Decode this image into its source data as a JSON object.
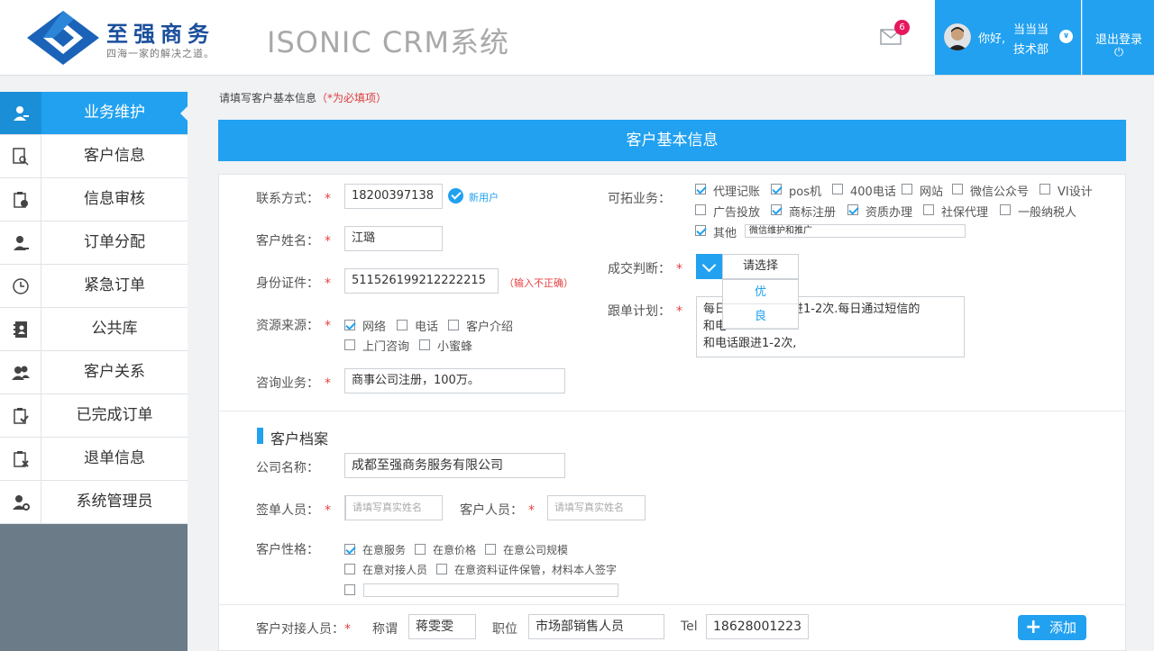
{
  "header": {
    "brand_name": "至强商务",
    "brand_tagline": "四海一家的解决之道。",
    "system_title": "ISONIC CRM系统",
    "mail_count": "6",
    "greeting": "你好,",
    "user_name": "当当当",
    "user_dept": "技术部",
    "logout_label": "退出登录",
    "logout_icon": "⏻"
  },
  "sidebar": {
    "items": [
      {
        "label": "业务维护",
        "icon": "user-edit-icon"
      },
      {
        "label": "客户信息",
        "icon": "search-doc-icon"
      },
      {
        "label": "信息审核",
        "icon": "clipboard-help-icon"
      },
      {
        "label": "订单分配",
        "icon": "user-dispatch-icon"
      },
      {
        "label": "紧急订单",
        "icon": "clock-icon"
      },
      {
        "label": "公共库",
        "icon": "contacts-book-icon"
      },
      {
        "label": "客户关系",
        "icon": "users-icon"
      },
      {
        "label": "已完成订单",
        "icon": "clipboard-check-icon"
      },
      {
        "label": "退单信息",
        "icon": "clipboard-x-icon"
      },
      {
        "label": "系统管理员",
        "icon": "user-gear-icon"
      }
    ]
  },
  "main": {
    "hint": "请填写客户基本信息",
    "hint_required": "（*为必填项）",
    "panel_title": "客户基本信息",
    "fields": {
      "contact_label": "联系方式：",
      "contact_value": "18200397138",
      "new_user": "新用户",
      "name_label": "客户姓名：",
      "name_value": "江璐",
      "id_label": "身份证件：",
      "id_value": "511526199212222215",
      "id_error": "（输入不正确）",
      "source_label": "资源来源：",
      "source_options": [
        {
          "label": "网络",
          "checked": true
        },
        {
          "label": "电话",
          "checked": false
        },
        {
          "label": "客户介绍",
          "checked": false
        },
        {
          "label": "上门咨询",
          "checked": false
        },
        {
          "label": "小蜜蜂",
          "checked": false
        }
      ],
      "consult_label": "咨询业务：",
      "consult_value": "商事公司注册，100万。",
      "expand_label": "可拓业务：",
      "expand_options": [
        {
          "label": "代理记账",
          "checked": true
        },
        {
          "label": "pos机",
          "checked": true
        },
        {
          "label": "400电话",
          "checked": false
        },
        {
          "label": "网站",
          "checked": false
        },
        {
          "label": "微信公众号",
          "checked": false
        },
        {
          "label": "VI设计",
          "checked": false
        },
        {
          "label": "广告投放",
          "checked": false
        },
        {
          "label": "商标注册",
          "checked": true
        },
        {
          "label": "资质办理",
          "checked": true
        },
        {
          "label": "社保代理",
          "checked": false
        },
        {
          "label": "一般纳税人",
          "checked": false
        },
        {
          "label": "其他",
          "checked": true
        }
      ],
      "other_value": "微信维护和推广",
      "deal_label": "成交判断：",
      "deal_placeholder": "请选择",
      "deal_options": [
        "优",
        "良"
      ],
      "plan_label": "跟单计划：",
      "plan_line1": "每日",
      "plan_line1b": "电话跟进1-2次.每日通过短信的",
      "plan_line2": "和电",
      "plan_line3": "和电话跟进1-2次,"
    },
    "archive": {
      "section_title": "客户档案",
      "company_label": "公司名称：",
      "company_value": "成都至强商务服务有限公司",
      "signer_label": "签单人员：",
      "signer_placeholder": "请填写真实姓名",
      "customer_staff_label": "客户人员：",
      "customer_staff_placeholder": "请填写真实姓名",
      "character_label": "客户性格：",
      "character_options": [
        {
          "label": "在意服务",
          "checked": true
        },
        {
          "label": "在意价格",
          "checked": false
        },
        {
          "label": "在意公司规模",
          "checked": false
        },
        {
          "label": "在意对接人员",
          "checked": false
        },
        {
          "label": "在意资料证件保管，材料本人签字",
          "checked": false
        }
      ]
    },
    "contact_person": {
      "label": "客户对接人员：",
      "title_label": "称谓",
      "title_value": "蒋雯雯",
      "position_label": "职位",
      "position_value": "市场部销售人员",
      "tel_label": "Tel",
      "tel_value": "18628001223",
      "add_label": "添加"
    }
  },
  "colors": {
    "accent": "#21a1f0",
    "required": "#e84040",
    "brand": "#1a4f9c",
    "sidebar_bg": "#6b7b88"
  }
}
